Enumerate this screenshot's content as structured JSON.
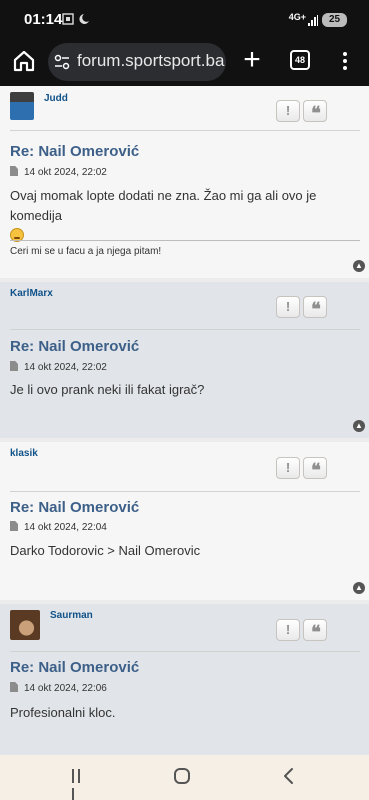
{
  "status_bar": {
    "time": "01:14",
    "network": "4G+",
    "battery": "25"
  },
  "browser": {
    "url": "forum.sportsport.ba",
    "tab_count": "48"
  },
  "posts": [
    {
      "username": "Judd",
      "title": "Re: Nail Omerović",
      "date": "14 okt 2024, 22:02",
      "content": "Ovaj momak lopte dodati ne zna. Žao mi ga ali ovo je komedija",
      "signature": "Ceri mi se u facu a ja njega pitam!",
      "has_avatar": true,
      "avatar_color": "#2E6FB0"
    },
    {
      "username": "KarlMarx",
      "title": "Re: Nail Omerović",
      "date": "14 okt 2024, 22:02",
      "content": "Je li ovo prank neki ili fakat igrač?",
      "has_avatar": false
    },
    {
      "username": "klasik",
      "title": "Re: Nail Omerović",
      "date": "14 okt 2024, 22:04",
      "content": "Darko Todorovic > Nail Omerovic",
      "has_avatar": false
    },
    {
      "username": "Saurman",
      "title": "Re: Nail Omerović",
      "date": "14 okt 2024, 22:06",
      "content": "Profesionalni kloc.",
      "has_avatar": true,
      "avatar_color": "#5A3A22"
    }
  ],
  "buttons": {
    "report_icon": "!",
    "quote_icon": "❝"
  },
  "colors": {
    "username": "#105289",
    "title": "#3D6089",
    "post_light": "#F6F6F6",
    "post_blue": "#E1E4E8"
  }
}
